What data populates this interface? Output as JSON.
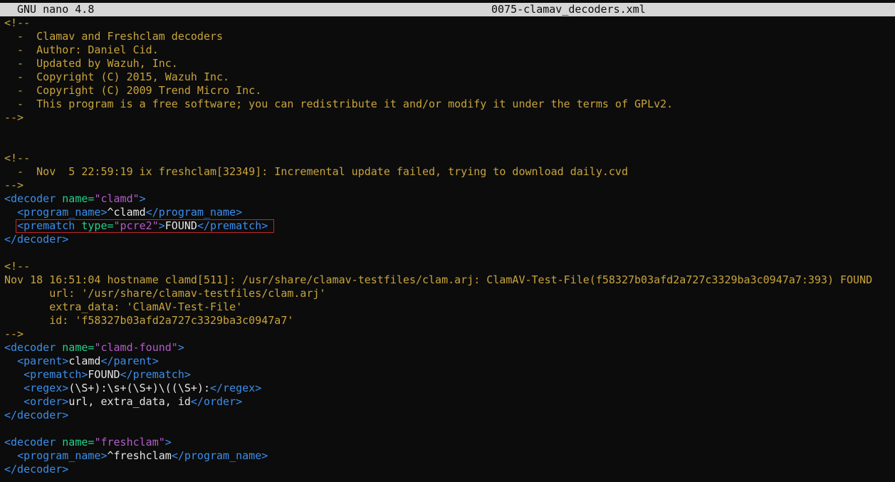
{
  "titlebar": {
    "app": "GNU nano 4.8",
    "filename": "0075-clamav_decoders.xml"
  },
  "lines": {
    "l01": "<!--",
    "l02": "  -  Clamav and Freshclam decoders",
    "l03": "  -  Author: Daniel Cid.",
    "l04": "  -  Updated by Wazuh, Inc.",
    "l05": "  -  Copyright (C) 2015, Wazuh Inc.",
    "l06": "  -  Copyright (C) 2009 Trend Micro Inc.",
    "l07": "  -  This program is a free software; you can redistribute it and/or modify it under the terms of GPLv2.",
    "l08": "-->",
    "l11": "<!--",
    "l12": "  -  Nov  5 22:59:19 ix freshclam[32349]: Incremental update failed, trying to download daily.cvd",
    "l13": "-->",
    "l20": "<!--",
    "l21": "Nov 18 16:51:04 hostname clamd[511]: /usr/share/clamav-testfiles/clam.arj: ClamAV-Test-File(f58327b03afd2a727c3329ba3c0947a7:393) FOUND",
    "l22": "       url: '/usr/share/clamav-testfiles/clam.arj'",
    "l23": "       extra_data: 'ClamAV-Test-File'",
    "l24": "       id: 'f58327b03afd2a727c3329ba3c0947a7'",
    "l25": "-->"
  },
  "xml": {
    "open_decoder": "<decoder",
    "close_decoder": "</decoder>",
    "name_attr": " name=",
    "type_attr": " type=",
    "gt": ">",
    "indent2": "  ",
    "indent3": "   ",
    "open_program_name": "<program_name>",
    "close_program_name": "</program_name>",
    "open_prematch": "<prematch",
    "open_prematch_full": "<prematch>",
    "close_prematch": "</prematch>",
    "open_parent": "<parent>",
    "close_parent": "</parent>",
    "open_regex": "<regex>",
    "close_regex": "</regex>",
    "open_order": "<order>",
    "close_order": "</order>"
  },
  "decoders": {
    "clamd": {
      "name": "\"clamd\"",
      "program_name": "^clamd",
      "prematch_type": "\"pcre2\"",
      "prematch": "FOUND"
    },
    "clamd_found": {
      "name": "\"clamd-found\"",
      "parent": "clamd",
      "prematch": "FOUND",
      "regex": "(\\S+):\\s+(\\S+)\\((\\S+):",
      "order": "url, extra_data, id"
    },
    "freshclam": {
      "name": "\"freshclam\"",
      "program_name": "^freshclam"
    }
  },
  "colors": {
    "background": "#0c0c0c",
    "comment": "#c8a43c",
    "tag": "#3b8eea",
    "attribute": "#23d18b",
    "value": "#b35cc9",
    "text": "#e5e5e5",
    "highlight_border": "#c0262a",
    "titlebar_bg": "#d6d6d6"
  }
}
